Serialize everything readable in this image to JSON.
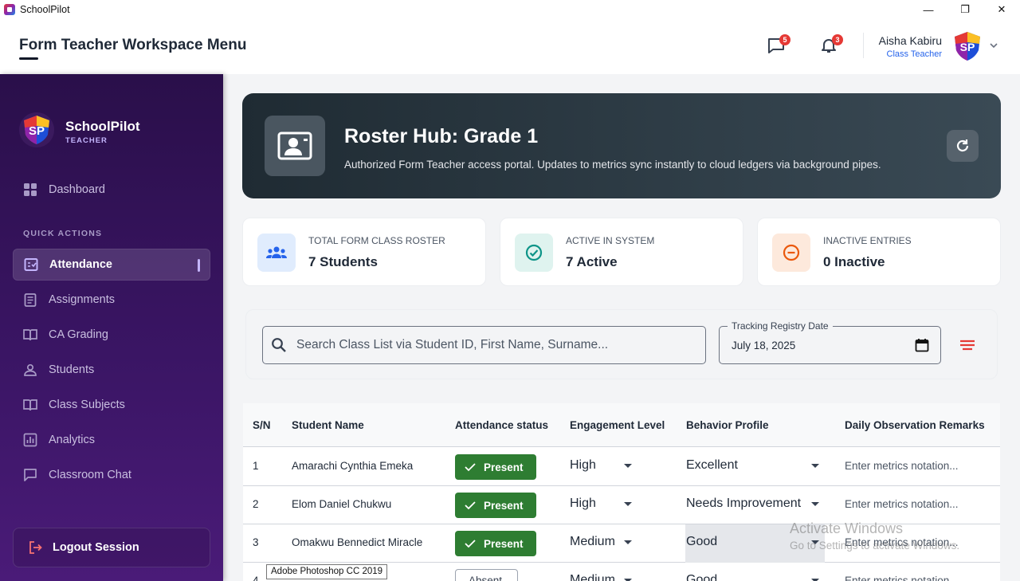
{
  "window": {
    "title": "SchoolPilot",
    "controls": [
      "—",
      "❐",
      "✕"
    ]
  },
  "header": {
    "title": "Form Teacher Workspace Menu",
    "messages_badge": "5",
    "notifications_badge": "3",
    "user_name": "Aisha Kabiru",
    "user_role": "Class Teacher"
  },
  "sidebar": {
    "brand_name": "SchoolPilot",
    "brand_sub": "TEACHER",
    "section_label": "QUICK ACTIONS",
    "items": [
      {
        "label": "Dashboard",
        "icon": "dashboard-icon"
      },
      {
        "label": "Attendance",
        "icon": "attendance-icon",
        "active": true
      },
      {
        "label": "Assignments",
        "icon": "assignments-icon"
      },
      {
        "label": "CA Grading",
        "icon": "book-icon"
      },
      {
        "label": "Students",
        "icon": "students-icon"
      },
      {
        "label": "Class Subjects",
        "icon": "book-icon"
      },
      {
        "label": "Analytics",
        "icon": "analytics-icon"
      },
      {
        "label": "Classroom Chat",
        "icon": "chat-icon"
      }
    ],
    "logout_label": "Logout Session"
  },
  "hero": {
    "title": "Roster Hub: Grade 1",
    "subtitle": "Authorized Form Teacher access portal. Updates to metrics sync instantly to cloud ledgers via background pipes."
  },
  "stats": [
    {
      "label": "TOTAL FORM CLASS ROSTER",
      "value": "7 Students",
      "color": "#2563eb"
    },
    {
      "label": "ACTIVE IN SYSTEM",
      "value": "7 Active",
      "color": "#0d9488"
    },
    {
      "label": "INACTIVE ENTRIES",
      "value": "0 Inactive",
      "color": "#ea580c"
    }
  ],
  "filters": {
    "search_placeholder": "Search Class List via Student ID, First Name, Surname...",
    "date_label": "Tracking Registry Date",
    "date_value": "July 18, 2025"
  },
  "table": {
    "headers": [
      "S/N",
      "Student Name",
      "Attendance status",
      "Engagement Level",
      "Behavior Profile",
      "Daily Observation Remarks"
    ],
    "rows": [
      {
        "sn": "1",
        "name": "Amarachi Cynthia  Emeka",
        "status": "Present",
        "engagement": "High",
        "behavior": "Excellent",
        "remarks_placeholder": "Enter metrics notation..."
      },
      {
        "sn": "2",
        "name": "Elom Daniel Chukwu",
        "status": "Present",
        "engagement": "High",
        "behavior": "Needs Improvement",
        "remarks_placeholder": "Enter metrics notation..."
      },
      {
        "sn": "3",
        "name": "Omakwu Bennedict Miracle",
        "status": "Present",
        "engagement": "Medium",
        "behavior": "Good",
        "remarks_placeholder": "Enter metrics notation..."
      },
      {
        "sn": "4",
        "name": "",
        "status": "Absent",
        "engagement": "Medium",
        "behavior": "Good",
        "remarks_placeholder": "Enter metrics notation..."
      }
    ]
  },
  "overlays": {
    "taskbar_tooltip": "Adobe Photoshop CC 2019",
    "watermark_title": "Activate Windows",
    "watermark_sub": "Go to Settings to activate Windows."
  }
}
